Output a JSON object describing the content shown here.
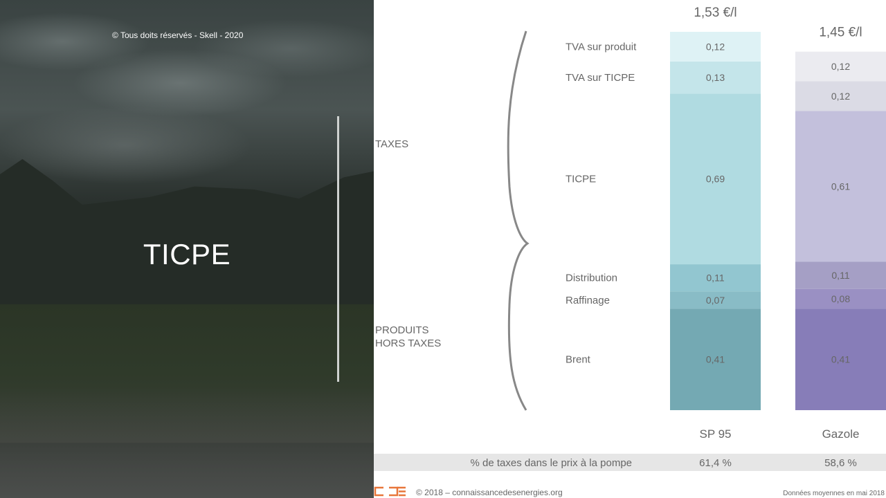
{
  "slide": {
    "copyright": "© Tous doits réservés - Skell - 2020",
    "title": "TICPE"
  },
  "chart_data": {
    "type": "bar",
    "stacked": true,
    "categories": [
      "SP 95",
      "Gazole"
    ],
    "totals": [
      "1,53 €/l",
      "1,45 €/l"
    ],
    "series": [
      {
        "name": "Brent",
        "values": [
          0.41,
          0.41
        ],
        "labels": [
          "0,41",
          "0,41"
        ],
        "colors": [
          "#74a9b3",
          "#877db8"
        ]
      },
      {
        "name": "Raffinage",
        "values": [
          0.07,
          0.08
        ],
        "labels": [
          "0,07",
          "0,08"
        ],
        "colors": [
          "#89bcc6",
          "#9a90c3"
        ]
      },
      {
        "name": "Distribution",
        "values": [
          0.11,
          0.11
        ],
        "labels": [
          "0,11",
          "0,11"
        ],
        "colors": [
          "#92c6d0",
          "#a59fc5"
        ]
      },
      {
        "name": "TICPE",
        "values": [
          0.69,
          0.61
        ],
        "labels": [
          "0,69",
          "0,61"
        ],
        "colors": [
          "#b0dbe1",
          "#c3c0dc"
        ]
      },
      {
        "name": "TVA sur TICPE",
        "values": [
          0.13,
          0.12
        ],
        "labels": [
          "0,13",
          "0,12"
        ],
        "colors": [
          "#c4e5ea",
          "#dbdbe5"
        ]
      },
      {
        "name": "TVA sur produit",
        "values": [
          0.12,
          0.12
        ],
        "labels": [
          "0,12",
          "0,12"
        ],
        "colors": [
          "#def2f5",
          "#ebebf0"
        ]
      }
    ],
    "groups": [
      "TAXES",
      "PRODUITS\nHORS TAXES"
    ],
    "footer_row": {
      "label": "% de taxes dans le prix à la pompe",
      "values": [
        "61,4 %",
        "58,6 %"
      ]
    },
    "source": "© 2018 – connaissancedesenergies.org",
    "note": "Données moyennes en mai 2018",
    "logo_text": "CDE"
  }
}
